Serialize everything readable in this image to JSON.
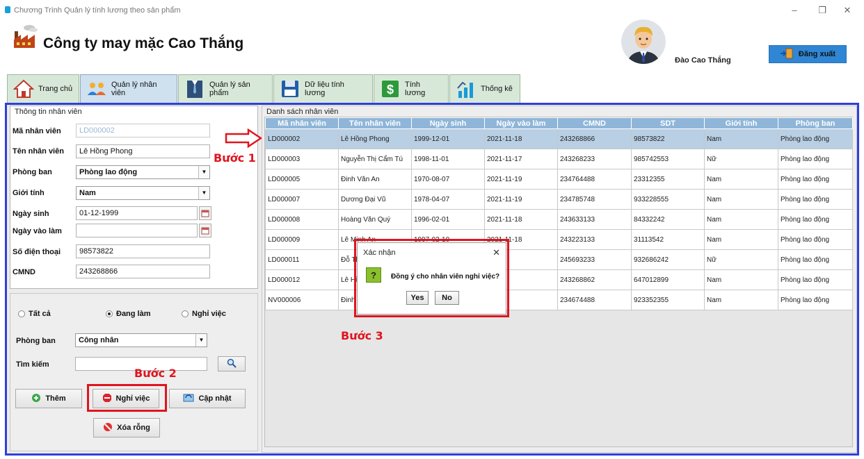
{
  "window": {
    "title": "Chương Trình Quản lý tính lương theo sản phẩm",
    "min_icon": "minimize-icon",
    "max_icon": "maximize-icon",
    "close_icon": "close-icon"
  },
  "header": {
    "company": "Công ty may mặc Cao Thắng",
    "user_name": "Đào Cao Thắng",
    "logout_label": "Đăng xuất"
  },
  "tabs": [
    {
      "label": "Trang chủ",
      "icon": "home-icon"
    },
    {
      "label": "Quản lý nhân viên",
      "icon": "users-icon"
    },
    {
      "label": "Quản lý sản phẩm",
      "icon": "shirt-icon"
    },
    {
      "label": "Dữ liệu tính lương",
      "icon": "floppy-icon"
    },
    {
      "label": "Tính lương",
      "icon": "dollar-icon"
    },
    {
      "label": "Thống kê",
      "icon": "chart-icon"
    }
  ],
  "employee_info": {
    "legend": "Thông tin nhân viên",
    "id_label": "Mã nhân viên",
    "id_value": "LD000002",
    "name_label": "Tên nhân viên",
    "name_value": "Lê Hồng Phong",
    "dept_label": "Phòng ban",
    "dept_value": "Phòng lao động",
    "gender_label": "Giới tính",
    "gender_value": "Nam",
    "birth_label": "Ngày sinh",
    "birth_value": "01-12-1999",
    "start_label": "Ngày vào làm",
    "start_value": "",
    "phone_label": "Số điện thoại",
    "phone_value": "98573822",
    "cmnd_label": "CMND",
    "cmnd_value": "243268866"
  },
  "filters": {
    "all_label": "Tất cả",
    "working_label": "Đang làm",
    "quit_label": "Nghỉ việc",
    "dept_label": "Phòng ban",
    "dept_value": "Công nhân",
    "search_label": "Tìm kiếm",
    "search_value": ""
  },
  "actions": {
    "add_label": "Thêm",
    "quit_label": "Nghỉ việc",
    "update_label": "Cập nhật",
    "clear_label": "Xóa rỗng"
  },
  "steps": {
    "step1": "Bước 1",
    "step2": "Bước 2",
    "step3": "Bước 3"
  },
  "list": {
    "legend": "Danh sách nhân viên",
    "columns": [
      "Mã nhân viên",
      "Tên nhân viên",
      "Ngày sinh",
      "Ngày vào làm",
      "CMND",
      "SDT",
      "Giới tính",
      "Phòng ban"
    ],
    "rows": [
      [
        "LD000002",
        "Lê Hồng Phong",
        "1999-12-01",
        "2021-11-18",
        "243268866",
        "98573822",
        "Nam",
        "Phòng lao động"
      ],
      [
        "LD000003",
        "Nguyễn Thị Cẩm Tú",
        "1998-11-01",
        "2021-11-17",
        "243268233",
        "985742553",
        "Nữ",
        "Phòng lao động"
      ],
      [
        "LD000005",
        "Đinh Văn An",
        "1970-08-07",
        "2021-11-19",
        "234764488",
        "23312355",
        "Nam",
        "Phòng lao động"
      ],
      [
        "LD000007",
        "Dương Đại Vũ",
        "1978-04-07",
        "2021-11-19",
        "234785748",
        "933228555",
        "Nam",
        "Phòng lao động"
      ],
      [
        "LD000008",
        "Hoàng Văn Quý",
        "1996-02-01",
        "2021-11-18",
        "243633133",
        "84332242",
        "Nam",
        "Phòng lao động"
      ],
      [
        "LD000009",
        "Lê Minh An",
        "1997-02-10",
        "2021-11-18",
        "243223133",
        "31113542",
        "Nam",
        "Phòng lao động"
      ],
      [
        "LD000011",
        "Đỗ Thị",
        "",
        "-18",
        "245693233",
        "932686242",
        "Nữ",
        "Phòng lao động"
      ],
      [
        "LD000012",
        "Lê Hồ",
        "",
        "-31",
        "243268862",
        "647012899",
        "Nam",
        "Phòng lao động"
      ],
      [
        "NV000006",
        "Đinh",
        "",
        "-19",
        "234674488",
        "923352355",
        "Nam",
        "Phòng lao động"
      ]
    ]
  },
  "dialog": {
    "title": "Xác nhận",
    "message": "Đồng ý cho nhân viên nghỉ việc?",
    "yes_label": "Yes",
    "no_label": "No"
  }
}
